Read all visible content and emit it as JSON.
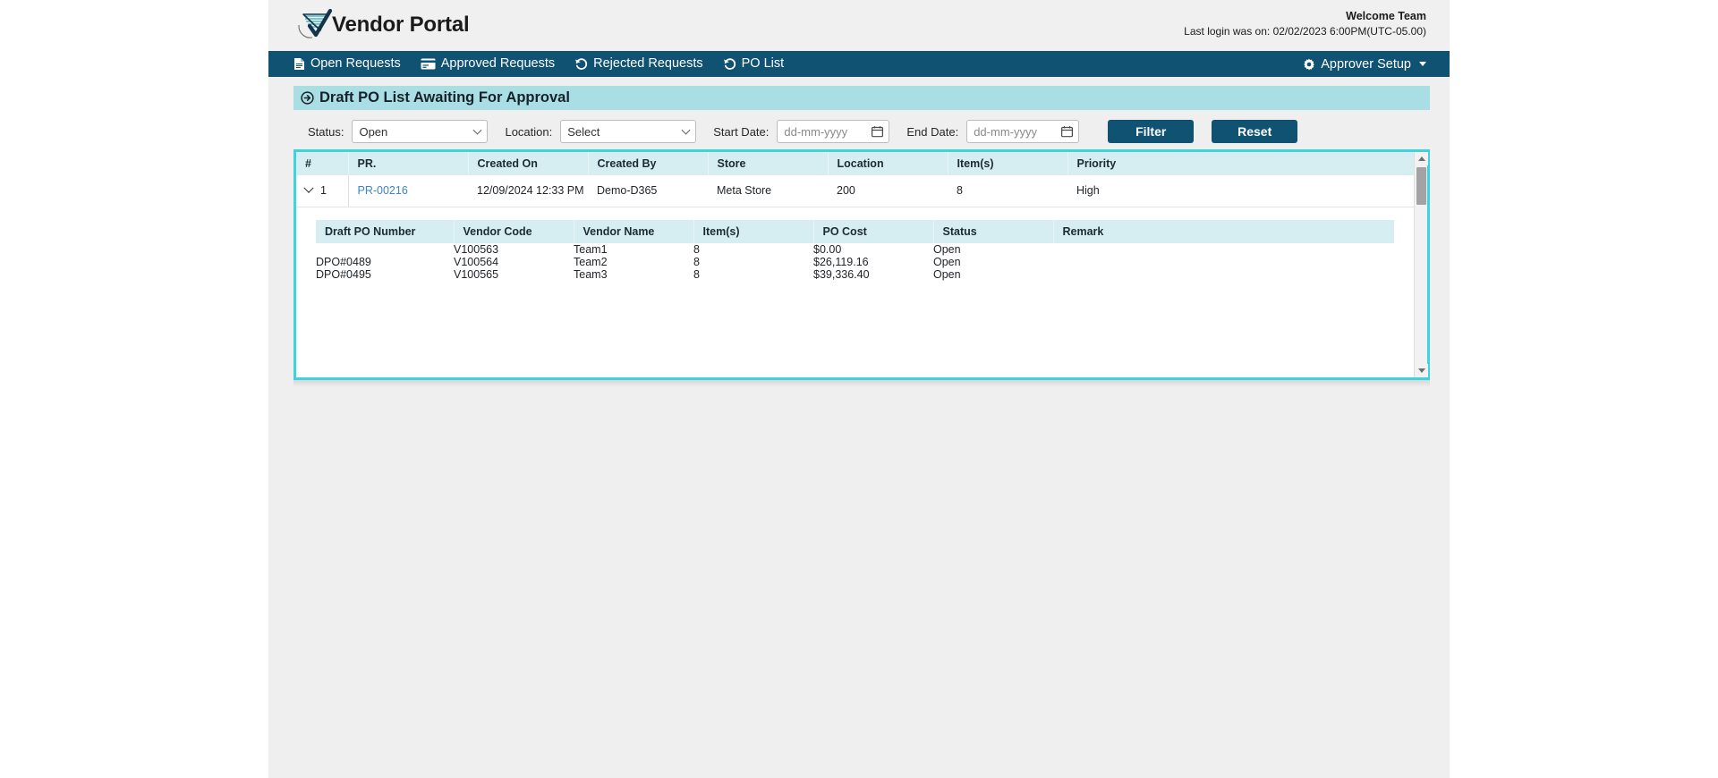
{
  "header": {
    "brand_name": "Vendor Portal",
    "logo_icon": "checkmark-flag-logo",
    "welcome_title": "Welcome Team",
    "last_login": "Last login was on: 02/02/2023 6:00PM(UTC-05.00)"
  },
  "nav": {
    "items": [
      {
        "label": "Open Requests",
        "icon": "document-icon"
      },
      {
        "label": "Approved Requests",
        "icon": "card-icon"
      },
      {
        "label": "Rejected Requests",
        "icon": "history-undo-icon"
      },
      {
        "label": "PO List",
        "icon": "history-undo-icon"
      }
    ],
    "right": {
      "label": "Approver Setup",
      "icon": "gear-icon",
      "caret": "chevron-down-icon"
    }
  },
  "panel": {
    "title": "Draft PO List Awaiting For Approval",
    "title_icon": "circle-arrow-icon"
  },
  "filters": {
    "status_label": "Status:",
    "status_value": "Open",
    "location_label": "Location:",
    "location_value": "Select",
    "start_date_label": "Start Date:",
    "start_date_placeholder": "dd-mm-yyyy",
    "start_date_value": "",
    "end_date_label": "End Date:",
    "end_date_placeholder": "dd-mm-yyyy",
    "end_date_value": "",
    "filter_button": "Filter",
    "reset_button": "Reset"
  },
  "table": {
    "columns": [
      "#",
      "PR.",
      "Created On",
      "Created By",
      "Store",
      "Location",
      "Item(s)",
      "Priority"
    ],
    "rows": [
      {
        "index": "1",
        "pr": "PR-00216",
        "created_on": "12/09/2024 12:33 PM",
        "created_by": "Demo-D365",
        "store": "Meta Store",
        "location": "200",
        "items": "8",
        "priority": "High"
      }
    ]
  },
  "nested_table": {
    "columns": [
      "Draft PO Number",
      "Vendor Code",
      "Vendor Name",
      "Item(s)",
      "PO Cost",
      "Status",
      "Remark"
    ],
    "rows": [
      {
        "draft_po": "",
        "vendor_code": "V100563",
        "vendor_name": "Team1",
        "items": "8",
        "po_cost": "$0.00",
        "status": "Open",
        "remark": ""
      },
      {
        "draft_po": "DPO#0489",
        "vendor_code": "V100564",
        "vendor_name": "Team2",
        "items": "8",
        "po_cost": "$26,119.16",
        "status": "Open",
        "remark": ""
      },
      {
        "draft_po": "DPO#0495",
        "vendor_code": "V100565",
        "vendor_name": "Team3",
        "items": "8",
        "po_cost": "$39,336.40",
        "status": "Open",
        "remark": ""
      }
    ]
  },
  "colors": {
    "nav_background": "#105271",
    "panel_title_background": "#a9dfe4",
    "grid_border": "#3fd3de",
    "table_header_background": "#d6eef2",
    "link": "#3b87c7",
    "button": "#105271"
  }
}
